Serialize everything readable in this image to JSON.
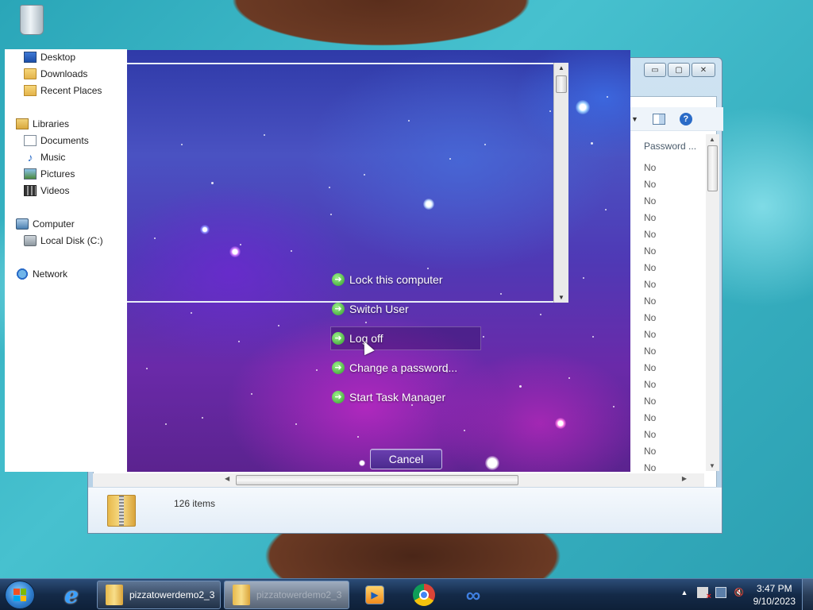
{
  "desktop": {
    "recycle_bin_icon": "recycle-bin-icon"
  },
  "explorer": {
    "column_header": "Password ...",
    "password_values": [
      "No",
      "No",
      "No",
      "No",
      "No",
      "No",
      "No",
      "No",
      "No",
      "No",
      "No",
      "No",
      "No",
      "No",
      "No",
      "No",
      "No",
      "No",
      "No"
    ],
    "status": "126 items",
    "nav": {
      "desktop": "Desktop",
      "downloads": "Downloads",
      "recent_places": "Recent Places",
      "libraries": "Libraries",
      "documents": "Documents",
      "music": "Music",
      "pictures": "Pictures",
      "videos": "Videos",
      "computer": "Computer",
      "local_disk": "Local Disk (C:)",
      "network": "Network"
    },
    "help_glyph": "?",
    "window_buttons": {
      "minimize": "▭",
      "maximize": "▢",
      "close": "✕"
    }
  },
  "security_screen": {
    "options": [
      {
        "label": "Lock this computer"
      },
      {
        "label": "Switch User"
      },
      {
        "label": "Log off"
      },
      {
        "label": "Change a password..."
      },
      {
        "label": "Start Task Manager"
      }
    ],
    "hovered_option": "Log off",
    "cancel_label": "Cancel",
    "option_icon": "green-arrow-icon"
  },
  "taskbar": {
    "task_buttons": [
      {
        "label": "pizzatowerdemo2_3",
        "state": "normal"
      },
      {
        "label": "pizzatowerdemo2_3",
        "state": "faded"
      }
    ],
    "clock_time": "3:47 PM",
    "clock_date": "9/10/2023"
  },
  "colors": {
    "taskbar": "#142a48",
    "security_bg": "#4f39b5",
    "option_arrow": "#2f9b2a"
  }
}
